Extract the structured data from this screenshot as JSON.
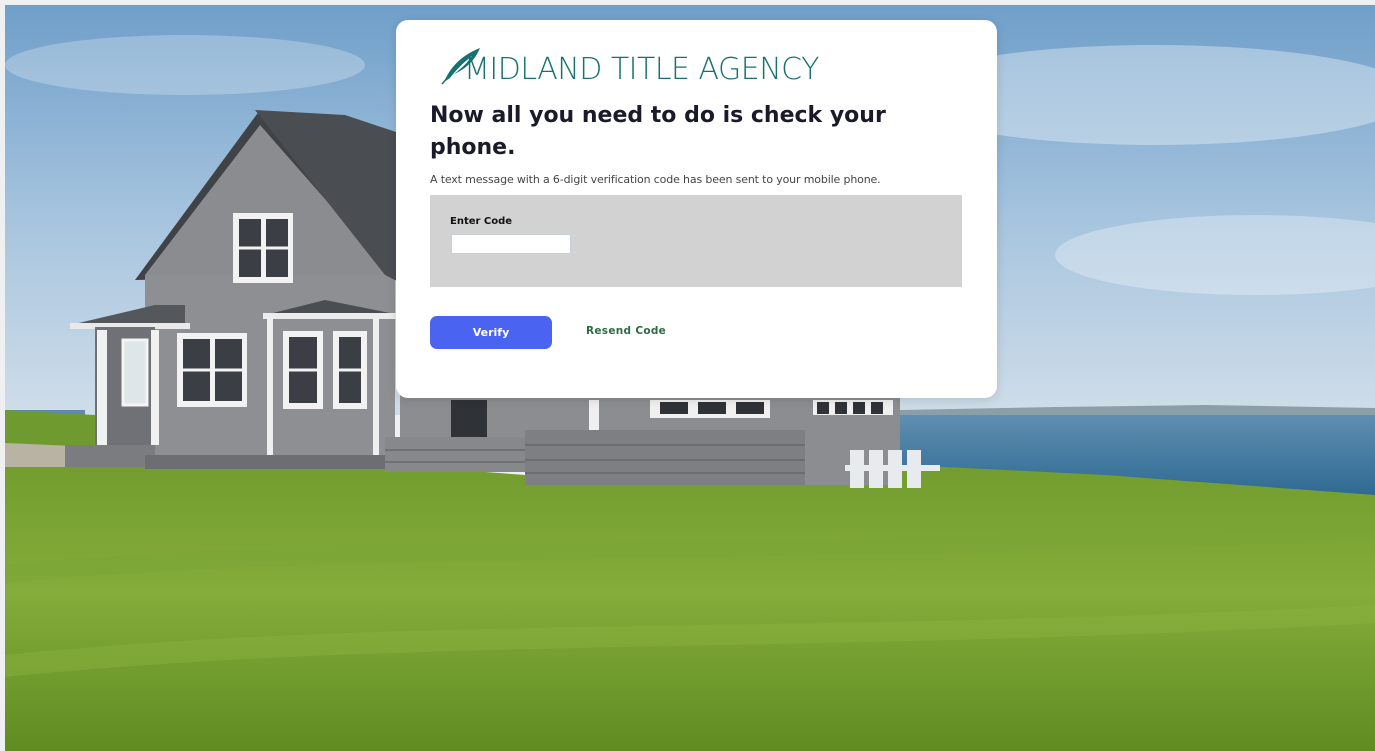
{
  "brand": {
    "name": "MIDLAND TITLE AGENCY",
    "color": "#17726e"
  },
  "verification": {
    "heading": "Now all you need to do is check your phone.",
    "message": "A text message with a 6-digit verification code has been sent to your mobile phone.",
    "code_label": "Enter Code",
    "code_value": "",
    "code_placeholder": ""
  },
  "actions": {
    "verify_label": "Verify",
    "resend_label": "Resend Code",
    "verify_color": "#4a63f0"
  },
  "icons": {
    "logo": "feather-icon"
  }
}
